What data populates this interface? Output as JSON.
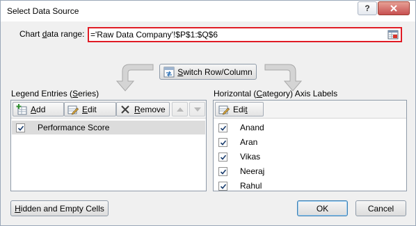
{
  "window": {
    "title": "Select Data Source",
    "help_label": "?",
    "close_icon": "close-x-icon"
  },
  "range": {
    "label_prefix": "Chart ",
    "label_underlined": "d",
    "label_suffix": "ata range:",
    "value": "='Raw Data Company'!$P$1:$Q$6",
    "picker_icon": "range-picker-icon"
  },
  "switch_button": {
    "label_prefix": "",
    "label_underlined": "S",
    "label_suffix": "witch Row/Column",
    "icon": "switch-icon"
  },
  "legend": {
    "header_prefix": "Legend Entries (",
    "header_underlined": "S",
    "header_suffix": "eries)",
    "add_u": "A",
    "add_rest": "dd",
    "edit_u": "E",
    "edit_rest": "dit",
    "remove_u": "R",
    "remove_rest": "emove",
    "items": [
      {
        "label": "Performance Score",
        "checked": true
      }
    ]
  },
  "axis": {
    "header_prefix": "Horizontal (",
    "header_underlined": "C",
    "header_suffix": "ategory) Axis Labels",
    "edit_prefix": "Edi",
    "edit_u": "t",
    "items": [
      {
        "label": "Anand",
        "checked": true
      },
      {
        "label": "Aran",
        "checked": true
      },
      {
        "label": "Vikas",
        "checked": true
      },
      {
        "label": "Neeraj",
        "checked": true
      },
      {
        "label": "Rahul",
        "checked": true
      }
    ]
  },
  "footer": {
    "hidden_u": "H",
    "hidden_rest": "idden and Empty Cells",
    "ok_label": "OK",
    "cancel_label": "Cancel"
  },
  "colors": {
    "highlight_border": "#e01b24",
    "close_button": "#c75050"
  }
}
